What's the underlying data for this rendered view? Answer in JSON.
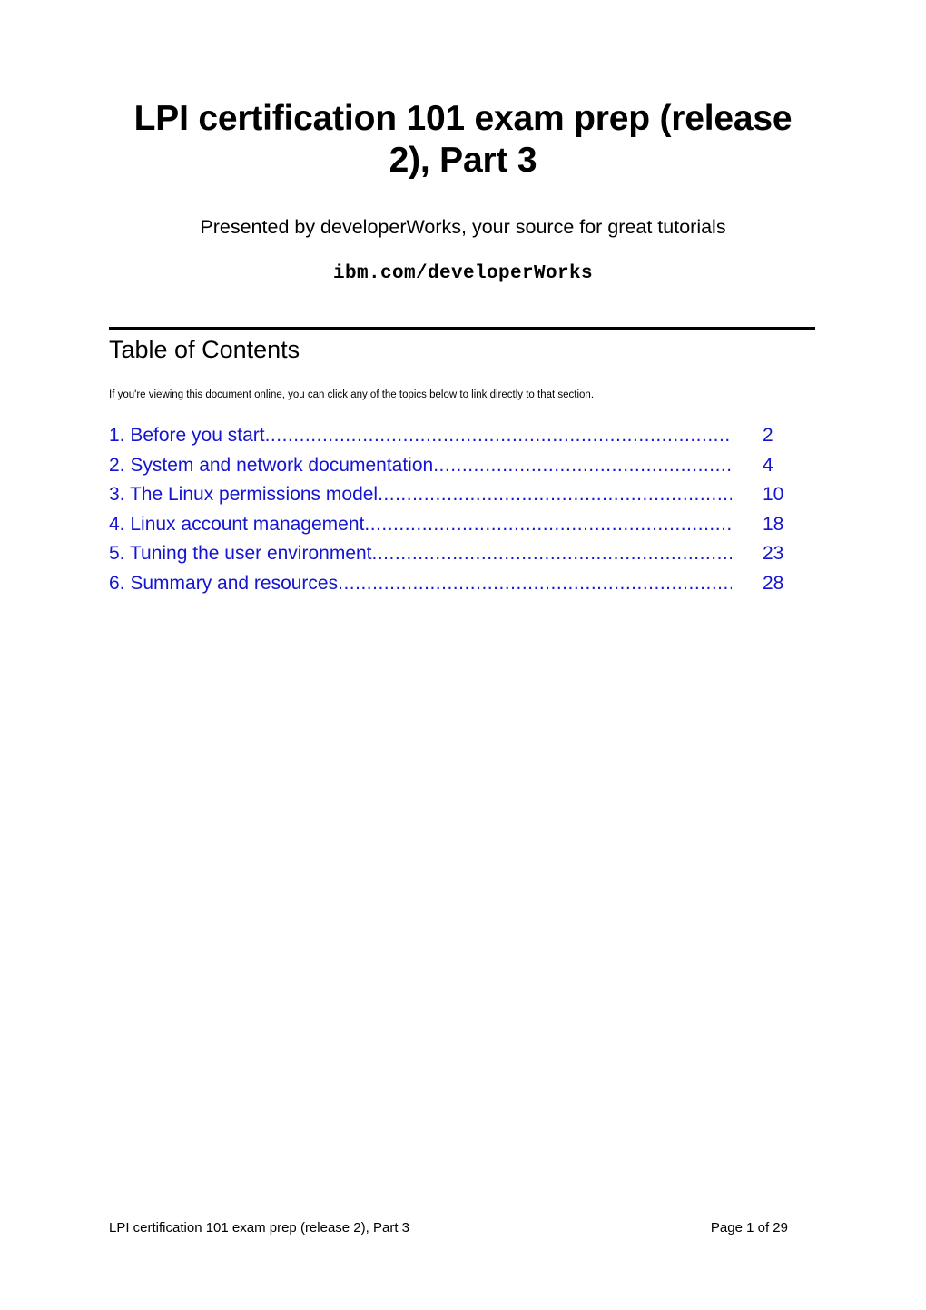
{
  "document": {
    "title": "LPI certification 101 exam prep (release 2), Part 3",
    "subtitle": "Presented by developerWorks, your source for great tutorials",
    "url": "ibm.com/developerWorks"
  },
  "toc": {
    "heading": "Table of Contents",
    "note": "If you're viewing this document online, you can click any of the topics below to link directly to that section.",
    "link_color": "#1414d2",
    "leader": "............................................................................................................",
    "entries": [
      {
        "label": "1. Before you start",
        "page": "2"
      },
      {
        "label": "2. System and network documentation",
        "page": "4"
      },
      {
        "label": "3. The Linux permissions model",
        "page": "10"
      },
      {
        "label": "4. Linux account management",
        "page": "18"
      },
      {
        "label": "5. Tuning the user environment",
        "page": "23"
      },
      {
        "label": "6. Summary and resources",
        "page": "28"
      }
    ]
  },
  "footer": {
    "left": "LPI certification 101 exam prep (release 2), Part 3",
    "right": "Page 1 of 29"
  }
}
